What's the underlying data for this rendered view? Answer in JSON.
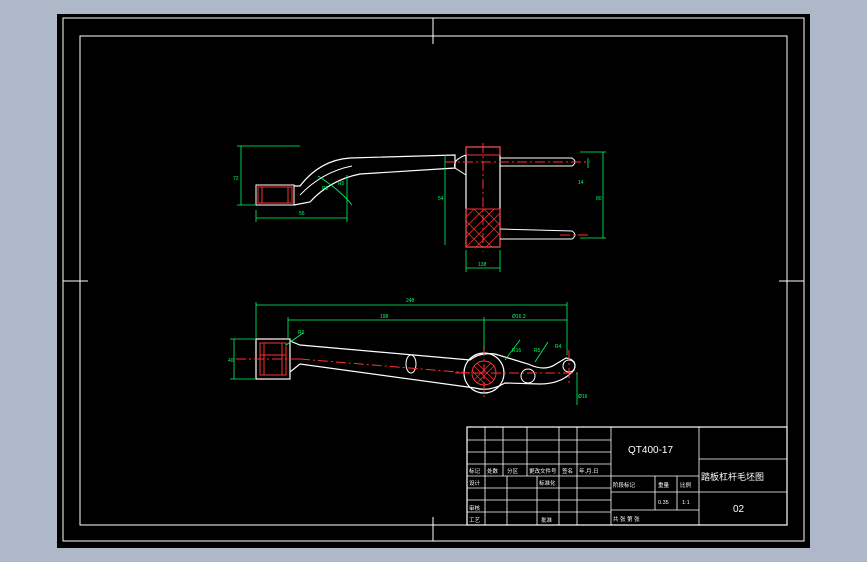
{
  "colors": {
    "viewport_bg": "#aeb8c9",
    "canvas": "#000000",
    "frame": "#ffffff",
    "dimension": "#00ff66",
    "centerline": "#ff3030",
    "hatch": "#ff3030"
  },
  "title_block": {
    "drawing_code": "QT400-17",
    "drawing_name": "踏板杠杆毛坯图",
    "sheet_number": "02",
    "row_labels": {
      "mark": "标记",
      "count": "处数",
      "zone": "分区",
      "change_doc": "更改文件号",
      "signature": "签名",
      "date": "年.月.日",
      "designer": "设计",
      "standardized": "标准化",
      "review": "审核",
      "process": "工艺",
      "approve": "批准"
    },
    "stage_label": "阶段标记",
    "weight_label": "重量",
    "scale_label": "比例",
    "scale_value": "1:1",
    "weight_value": "0.35",
    "sheets_label": "共 张 第 张"
  }
}
